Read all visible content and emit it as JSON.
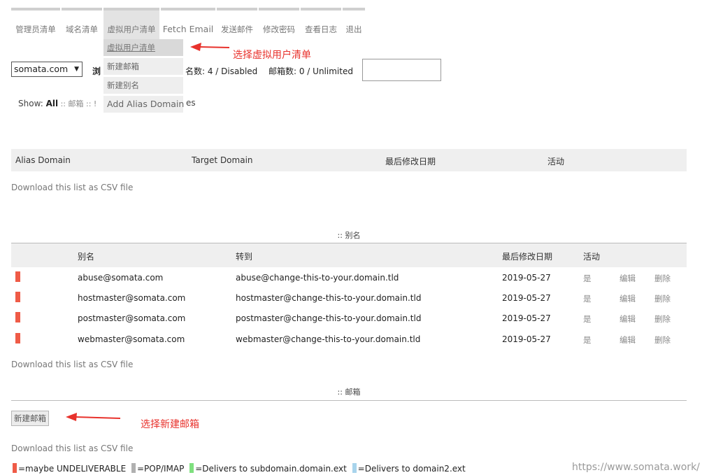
{
  "menu": {
    "items": [
      {
        "label": "管理员清单"
      },
      {
        "label": "域名清单"
      },
      {
        "label": "虚拟用户清单"
      },
      {
        "label": "Fetch Email"
      },
      {
        "label": "发送邮件"
      },
      {
        "label": "修改密码"
      },
      {
        "label": "查看日志"
      },
      {
        "label": "退出"
      }
    ]
  },
  "dropdown": {
    "items": [
      {
        "label": "虚拟用户清单"
      },
      {
        "label": "新建邮箱"
      },
      {
        "label": "新建别名"
      },
      {
        "label": "Add Alias Domain"
      }
    ]
  },
  "annotations": {
    "select_virtual_list": "选择虚拟用户清单",
    "select_new_mailbox": "选择新建邮箱"
  },
  "domain_select": {
    "value": "somata.com"
  },
  "stats": {
    "partial_label": "浏",
    "aliases": "名数: 4 / Disabled",
    "mailboxes": "邮箱数: 0 / Unlimited"
  },
  "filter": {
    "show_label": "Show:",
    "all": "All",
    "sep1": " :: 邮箱 :: !",
    "tail": "es"
  },
  "alias_domain_table": {
    "headers": [
      "Alias Domain",
      "Target Domain",
      "最后修改日期",
      "活动"
    ],
    "csv": "Download this list as CSV file"
  },
  "alias_section": {
    "title": ":: 别名",
    "headers": [
      "别名",
      "转到",
      "最后修改日期",
      "活动"
    ],
    "rows": [
      {
        "alias": "abuse@somata.com",
        "goto": "abuse@change-this-to-your.domain.tld",
        "modified": "2019-05-27",
        "active": "是",
        "edit": "编辑",
        "delete": "删除"
      },
      {
        "alias": "hostmaster@somata.com",
        "goto": "hostmaster@change-this-to-your.domain.tld",
        "modified": "2019-05-27",
        "active": "是",
        "edit": "编辑",
        "delete": "删除"
      },
      {
        "alias": "postmaster@somata.com",
        "goto": "postmaster@change-this-to-your.domain.tld",
        "modified": "2019-05-27",
        "active": "是",
        "edit": "编辑",
        "delete": "删除"
      },
      {
        "alias": "webmaster@somata.com",
        "goto": "webmaster@change-this-to-your.domain.tld",
        "modified": "2019-05-27",
        "active": "是",
        "edit": "编辑",
        "delete": "删除"
      }
    ],
    "csv": "Download this list as CSV file"
  },
  "mailbox_section": {
    "title": ":: 邮箱",
    "new_button": "新建邮箱",
    "csv": "Download this list as CSV file"
  },
  "legend": {
    "items": [
      {
        "label": "=maybe UNDELIVERABLE",
        "color": "#ef5b47"
      },
      {
        "label": "=POP/IMAP",
        "color": "#b0b0b0"
      },
      {
        "label": "=Delivers to subdomain.domain.ext",
        "color": "#7fe07f"
      },
      {
        "label": "=Delivers to domain2.ext",
        "color": "#a8d4ec"
      }
    ]
  },
  "watermark": "https://www.somata.work/",
  "colors": {
    "accent_red": "#e8322c",
    "marker_red": "#ef5b47"
  }
}
